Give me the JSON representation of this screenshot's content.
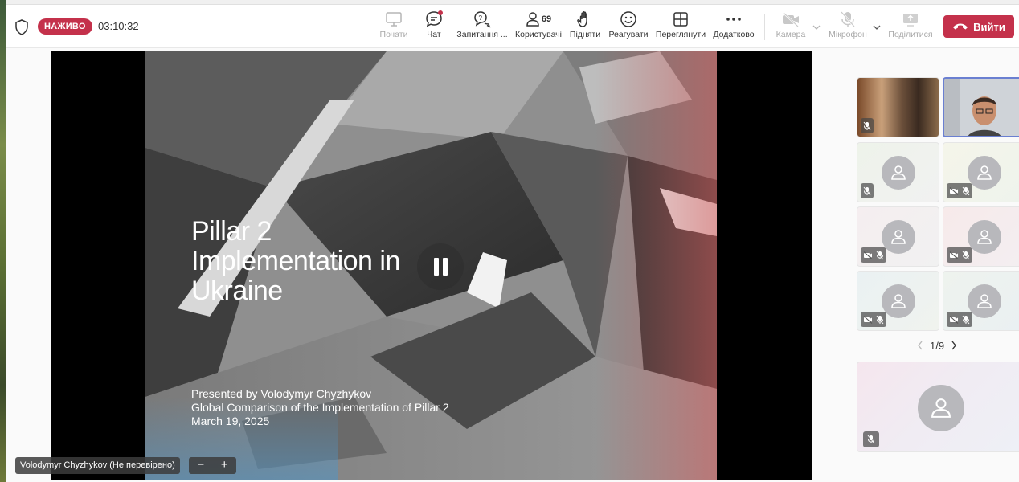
{
  "toolbar": {
    "live_badge": "НАЖИВО",
    "timer": "03:10:32",
    "buttons": {
      "start": "Почати",
      "chat": "Чат",
      "questions": "Запитання ...",
      "users": "Користувачі",
      "users_count": "69",
      "raise": "Підняти",
      "react": "Реагувати",
      "view": "Переглянути",
      "more": "Додатково",
      "camera": "Камера",
      "mic": "Мікрофон",
      "share": "Поділитися"
    },
    "leave": "Вийти"
  },
  "slide": {
    "title_lines": [
      "Pillar 2",
      "Implementation in",
      "Ukraine"
    ],
    "presenter_line": "Presented by Volodymyr Chyzhykov",
    "subtitle_line": "Global Comparison of the Implementation of Pillar 2",
    "date_line": "March 19, 2025"
  },
  "presenter_label": "Volodymyr Chyzhykov (Не перевірено)",
  "zoom": {
    "minus": "−",
    "plus": "+"
  },
  "participants": {
    "pager": "1/9"
  },
  "colors": {
    "accent_red": "#c4314b",
    "live_red": "#c4314b"
  }
}
